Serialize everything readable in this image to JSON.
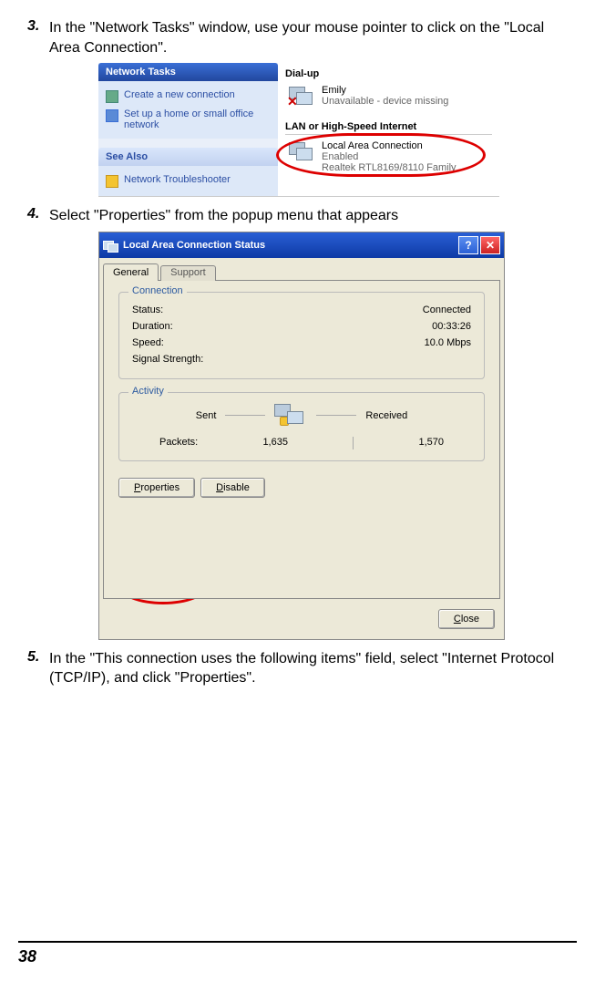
{
  "steps": {
    "s3": {
      "num": "3.",
      "text": "In the \"Network Tasks\" window, use your mouse pointer to click on the \"Local Area Connection\"."
    },
    "s4": {
      "num": "4.",
      "text": "Select \"Properties\" from the popup menu that appears"
    },
    "s5": {
      "num": "5.",
      "text": "In the \"This connection uses the following items\" field, select \"Internet Protocol (TCP/IP), and click \"Properties\"."
    }
  },
  "fig1": {
    "panel1_title": "Network Tasks",
    "task1": "Create a new connection",
    "task2": "Set up a home or small office network",
    "panel2_title": "See Also",
    "task3": "Network Troubleshooter",
    "cat1": "Dial-up",
    "dial_name": "Emily",
    "dial_status": "Unavailable - device missing",
    "cat2": "LAN or High-Speed Internet",
    "lan_name": "Local Area Connection",
    "lan_status": "Enabled",
    "lan_device": "Realtek RTL8169/8110 Family"
  },
  "fig2": {
    "title": "Local Area Connection Status",
    "tab_general": "General",
    "tab_support": "Support",
    "grp_conn": "Connection",
    "status_l": "Status:",
    "status_v": "Connected",
    "dur_l": "Duration:",
    "dur_v": "00:33:26",
    "speed_l": "Speed:",
    "speed_v": "10.0 Mbps",
    "sig_l": "Signal Strength:",
    "grp_act": "Activity",
    "sent": "Sent",
    "recv": "Received",
    "pkts_l": "Packets:",
    "pkts_sent": "1,635",
    "pkts_recv": "1,570",
    "btn_props": "Properties",
    "btn_disable": "Disable",
    "btn_close": "Close"
  },
  "page_number": "38"
}
